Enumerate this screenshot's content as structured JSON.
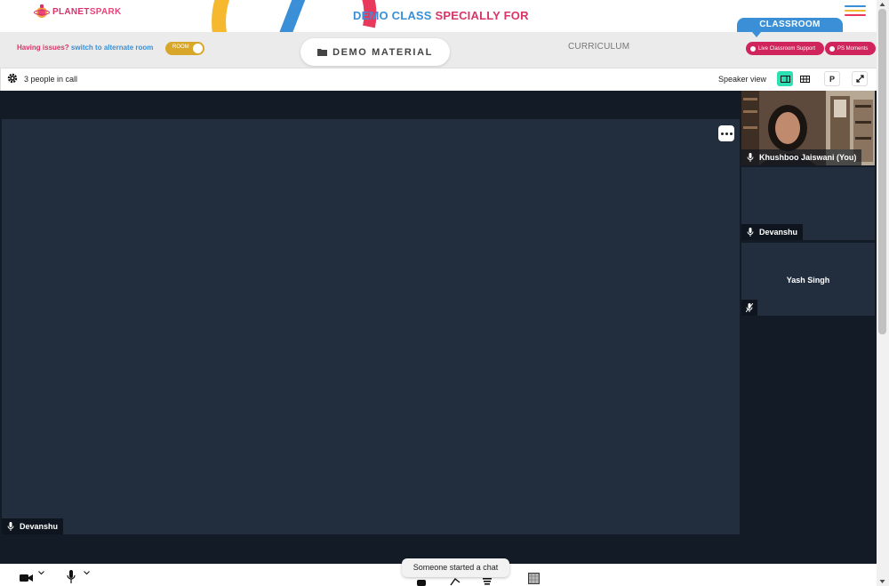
{
  "header": {
    "logo_text_1": "PLANET",
    "logo_text_2": "SPARK",
    "title_part_1": "DEMO CLASS",
    "title_part_2": "SPECIALLY FOR",
    "classroom_tab": "CLASSROOM"
  },
  "toolbar": {
    "issues_text": "Having issues?",
    "switch_link": "switch to alternate room",
    "toggle_label": "ROOM",
    "demo_material": "DEMO MATERIAL",
    "curriculum": "CURRICULUM",
    "live_support": "Live Classroom Support",
    "ps_moments": "PS Moments"
  },
  "call": {
    "people_count": "3 people in call",
    "speaker_view_label": "Speaker view",
    "p_button": "P"
  },
  "main_video": {
    "name": "Devanshu"
  },
  "participants": [
    {
      "name": "Khushboo Jaiswani (You)",
      "muted": false,
      "video": true
    },
    {
      "name": "Devanshu",
      "muted": false,
      "video": false
    },
    {
      "name": "Yash Singh",
      "muted": true,
      "video": false
    }
  ],
  "toast": "Someone started a chat",
  "colors": {
    "brand_pink": "#d93468",
    "brand_blue": "#3a8fd6",
    "accent_teal": "#2de0b3",
    "stage_dark": "#131c26",
    "video_bg": "#222e3e"
  }
}
